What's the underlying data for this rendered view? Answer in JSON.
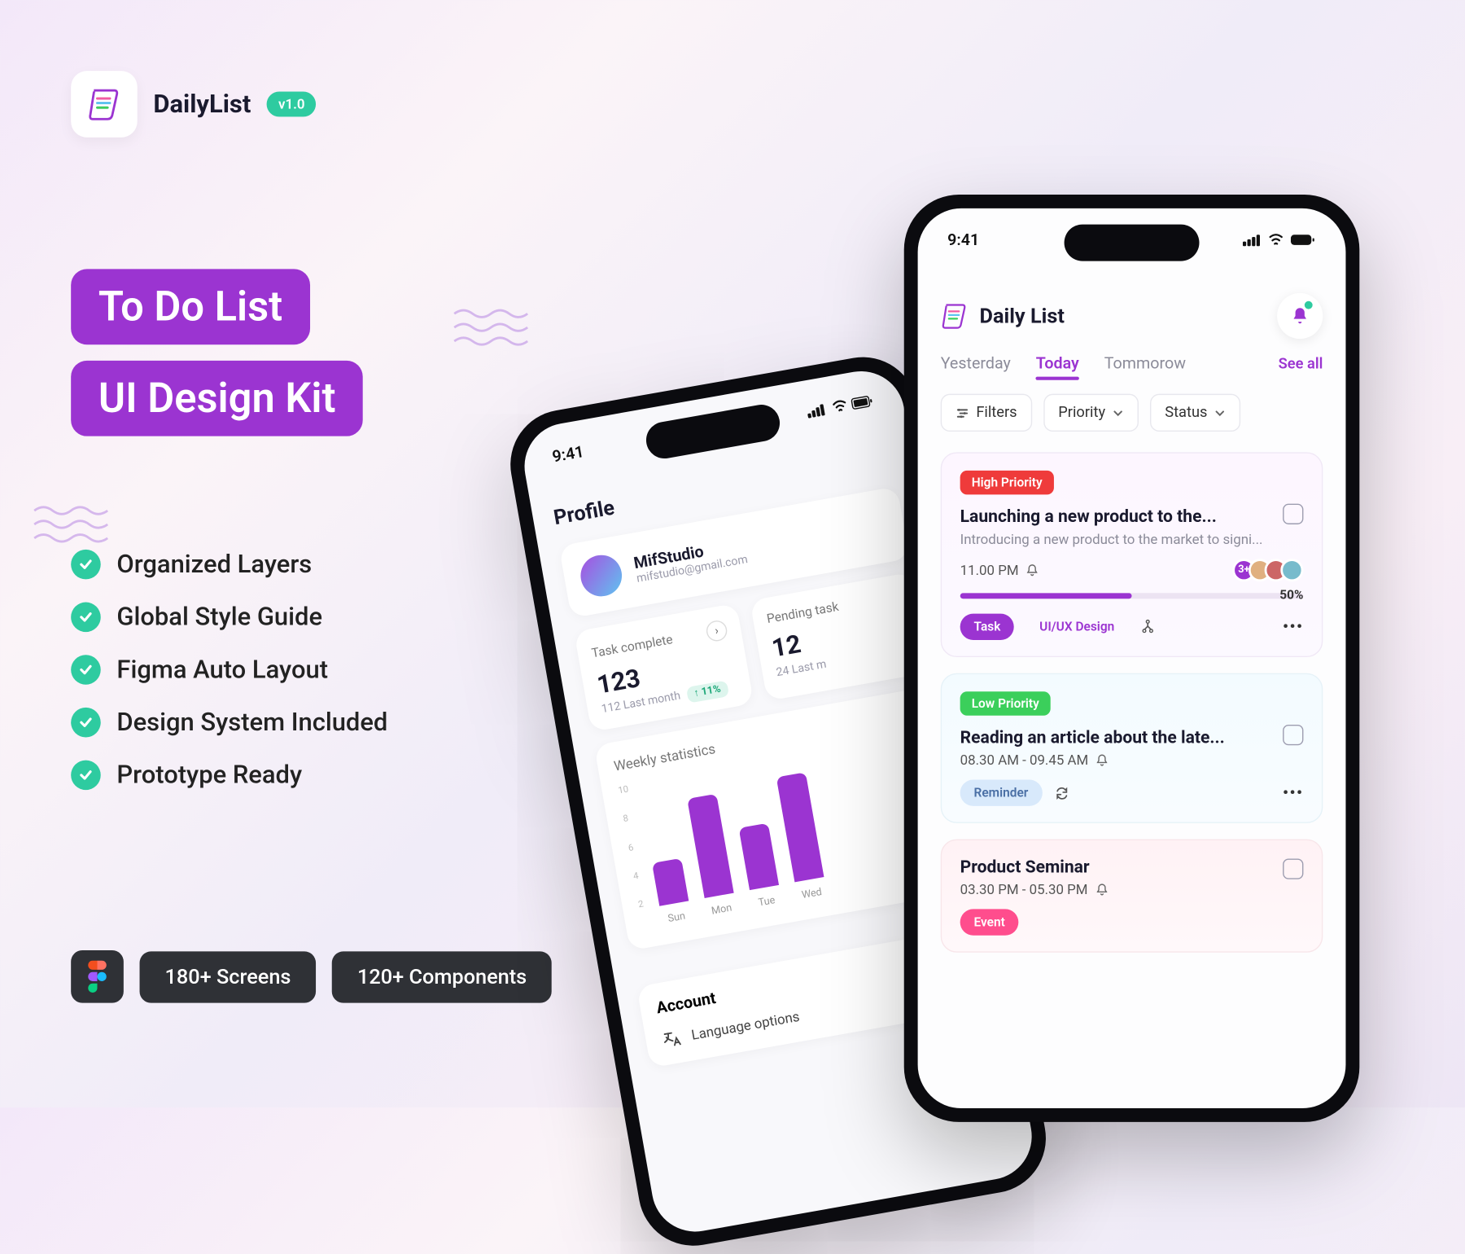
{
  "brand": {
    "name": "DailyList",
    "version": "v1.0"
  },
  "headline": {
    "line1": "To Do List",
    "line2": "UI Design Kit"
  },
  "features": [
    "Organized Layers",
    "Global Style Guide",
    "Figma Auto Layout",
    "Design System Included",
    "Prototype Ready"
  ],
  "badges": {
    "screens": "180+ Screens",
    "components": "120+ Components"
  },
  "phoneB": {
    "time": "9:41",
    "title": "Daily List",
    "tabs": [
      "Yesterday",
      "Today",
      "Tommorow"
    ],
    "tab_active": 1,
    "seeall": "See all",
    "chips": {
      "filters": "Filters",
      "priority": "Priority",
      "status": "Status"
    },
    "cards": [
      {
        "priority": "High Priority",
        "title": "Launching a new product to the...",
        "desc": "Introducing a new product to the market to signi...",
        "time": "11.00 PM",
        "avmore": "3+",
        "progress": 50,
        "progress_label": "50%",
        "tags": {
          "a": "Task",
          "b": "UI/UX Design"
        }
      },
      {
        "priority": "Low Priority",
        "title": "Reading an article about the late...",
        "time": "08.30 AM - 09.45 AM",
        "tag": "Reminder"
      },
      {
        "title": "Product Seminar",
        "time": "03.30 PM - 05.30 PM",
        "tag": "Event"
      }
    ]
  },
  "phoneA": {
    "time": "9:41",
    "heading": "Profile",
    "profile": {
      "name": "MifStudio",
      "mail": "mifstudio@gmail.com"
    },
    "stat1": {
      "label": "Task complete",
      "value": "123",
      "sub": "112 Last month",
      "delta": "↑ 11%"
    },
    "stat2": {
      "label": "Pending task",
      "value": "12",
      "sub": "24 Last m"
    },
    "weekly": {
      "label": "Weekly statistics"
    },
    "account": {
      "label": "Account",
      "item": "Language options"
    }
  },
  "chart_data": {
    "type": "bar",
    "title": "Weekly statistics",
    "categories": [
      "Sun",
      "Mon",
      "Tue",
      "Wed"
    ],
    "values": [
      3.5,
      8,
      5,
      8.5
    ],
    "ylim": [
      0,
      10
    ],
    "yticks": [
      10,
      8,
      6,
      4,
      2
    ],
    "xlabel": "",
    "ylabel": ""
  }
}
